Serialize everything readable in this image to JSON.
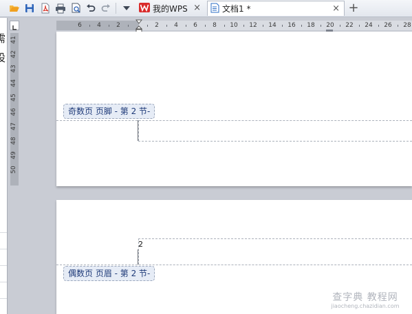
{
  "toolbar": {
    "buttons": [
      {
        "name": "open-icon",
        "color": "#f0a020"
      },
      {
        "name": "save-icon",
        "color": "#2c63b8"
      },
      {
        "name": "export-pdf-icon",
        "color": "#d83a2e"
      },
      {
        "name": "print-icon",
        "color": "#4f5a6a"
      },
      {
        "name": "print-preview-icon",
        "color": "#4f5a6a"
      },
      {
        "name": "undo-icon",
        "color": "#3d4654"
      },
      {
        "name": "redo-icon",
        "color": "#9aa2ad"
      },
      {
        "name": "customize-dropdown-icon",
        "color": "#3d4654"
      }
    ]
  },
  "tabs": [
    {
      "label": "我的WPS",
      "icon": "wps-logo-icon",
      "icon_color": "#d92b2b",
      "close": "×",
      "active": false
    },
    {
      "label": "文档1 *",
      "icon": "document-icon",
      "icon_color": "#2b6cc4",
      "close": "×",
      "active": true
    }
  ],
  "new_tab": "+",
  "ruler": {
    "horizontal_numbers": [
      "6",
      "4",
      "2",
      "2",
      "4",
      "6",
      "8",
      "10",
      "12",
      "14",
      "16",
      "18",
      "20",
      "22",
      "24",
      "26",
      "28"
    ],
    "vertical_numbers": [
      "41",
      "42",
      "43",
      "44",
      "45",
      "46",
      "47",
      "48",
      "49",
      "50"
    ]
  },
  "left_strip": {
    "chars": [
      "需",
      "设"
    ]
  },
  "page1": {
    "footer_label": "奇数页 页脚 - 第 2 节-"
  },
  "page2": {
    "header_label": "偶数页 页眉 - 第 2 节-",
    "page_number": "2"
  },
  "watermark": {
    "line1": "查字典 教程网",
    "line2": "jiaocheng.chazidian.com"
  }
}
